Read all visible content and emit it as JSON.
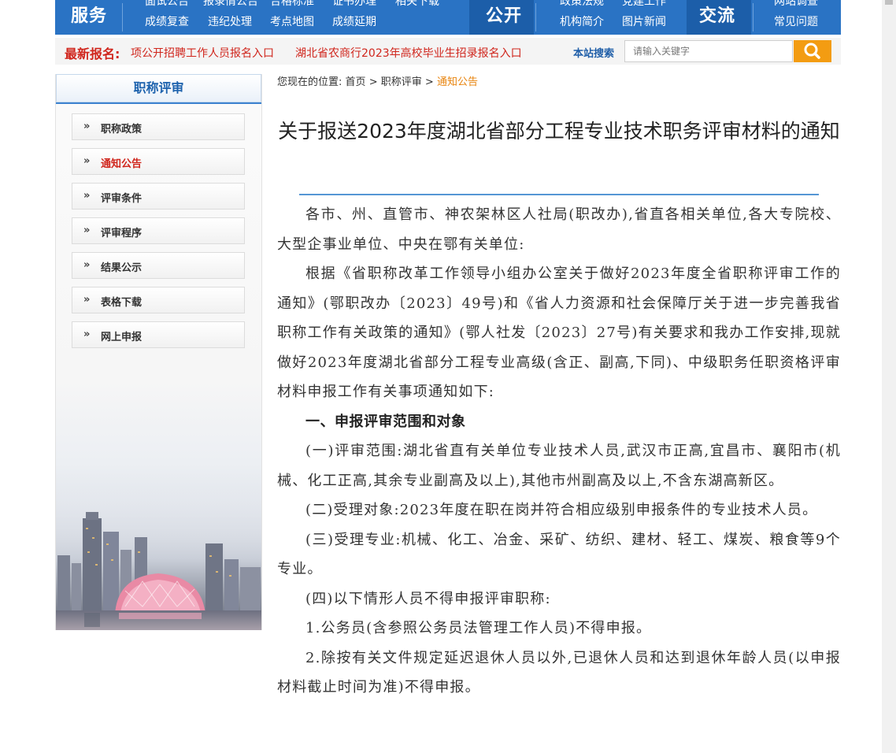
{
  "top_nav": {
    "sections": [
      {
        "title": "服务",
        "cut_links": [
          "面试公告",
          "报录情公告",
          "合格标准",
          "证书办理",
          "相关下载"
        ],
        "links": [
          "成绩复查",
          "违纪处理",
          "考点地图",
          "成绩延期"
        ]
      },
      {
        "title": "公开",
        "cut_links": [
          "政策法规",
          "党建工作"
        ],
        "links": [
          "机构简介",
          "图片新闻"
        ]
      },
      {
        "title": "交流",
        "cut_links": [
          "网站调查"
        ],
        "links": [
          "常见问题"
        ]
      }
    ]
  },
  "ticker": {
    "label": "最新报名:",
    "items": [
      "项公开招聘工作人员报名入口",
      "湖北省农商行2023年高校毕业生招录报名入口"
    ]
  },
  "search": {
    "label": "本站搜索",
    "placeholder": "请输入关键字",
    "button_icon": "search-icon"
  },
  "sidebar": {
    "title": "职称评审",
    "items": [
      {
        "label": "职称政策",
        "active": false
      },
      {
        "label": "通知公告",
        "active": true
      },
      {
        "label": "评审条件",
        "active": false
      },
      {
        "label": "评审程序",
        "active": false
      },
      {
        "label": "结果公示",
        "active": false
      },
      {
        "label": "表格下载",
        "active": false
      },
      {
        "label": "网上申报",
        "active": false
      }
    ],
    "arrow_glyph": "»"
  },
  "breadcrumb": {
    "prefix": "您现在的位置:",
    "home": "首页",
    "sep": ">",
    "parent": "职称评审",
    "current": "通知公告"
  },
  "article": {
    "title": "关于报送2023年度湖北省部分工程专业技术职务评审材料的通知",
    "paragraphs": [
      "各市、州、直管市、神农架林区人社局(职改办),省直各相关单位,各大专院校、大型企事业单位、中央在鄂有关单位:",
      "根据《省职称改革工作领导小组办公室关于做好2023年度全省职称评审工作的通知》(鄂职改办〔2023〕49号)和《省人力资源和社会保障厅关于进一步完善我省职称工作有关政策的通知》(鄂人社发〔2023〕27号)有关要求和我办工作安排,现就做好2023年度湖北省部分工程专业高级(含正、副高,下同)、中级职务任职资格评审材料申报工作有关事项通知如下:",
      "一、申报评审范围和对象",
      "(一)评审范围:湖北省直有关单位专业技术人员,武汉市正高,宜昌市、襄阳市(机械、化工正高,其余专业副高及以上),其他市州副高及以上,不含东湖高新区。",
      "(二)受理对象:2023年度在职在岗并符合相应级别申报条件的专业技术人员。",
      "(三)受理专业:机械、化工、冶金、采矿、纺织、建材、轻工、煤炭、粮食等9个专业。",
      "(四)以下情形人员不得申报评审职称:",
      "1.公务员(含参照公务员法管理工作人员)不得申报。",
      "2.除按有关文件规定延迟退休人员以外,已退休人员和达到退休年龄人员(以申报材料截止时间为准)不得申报。"
    ]
  },
  "colors": {
    "nav_blue": "#2a73c4",
    "nav_dark": "#1c5ea9",
    "ticker_red": "#d0261d",
    "search_orange": "#f39c12",
    "breadcrumb_current": "#e8840e",
    "rule_blue": "#5596d4"
  }
}
